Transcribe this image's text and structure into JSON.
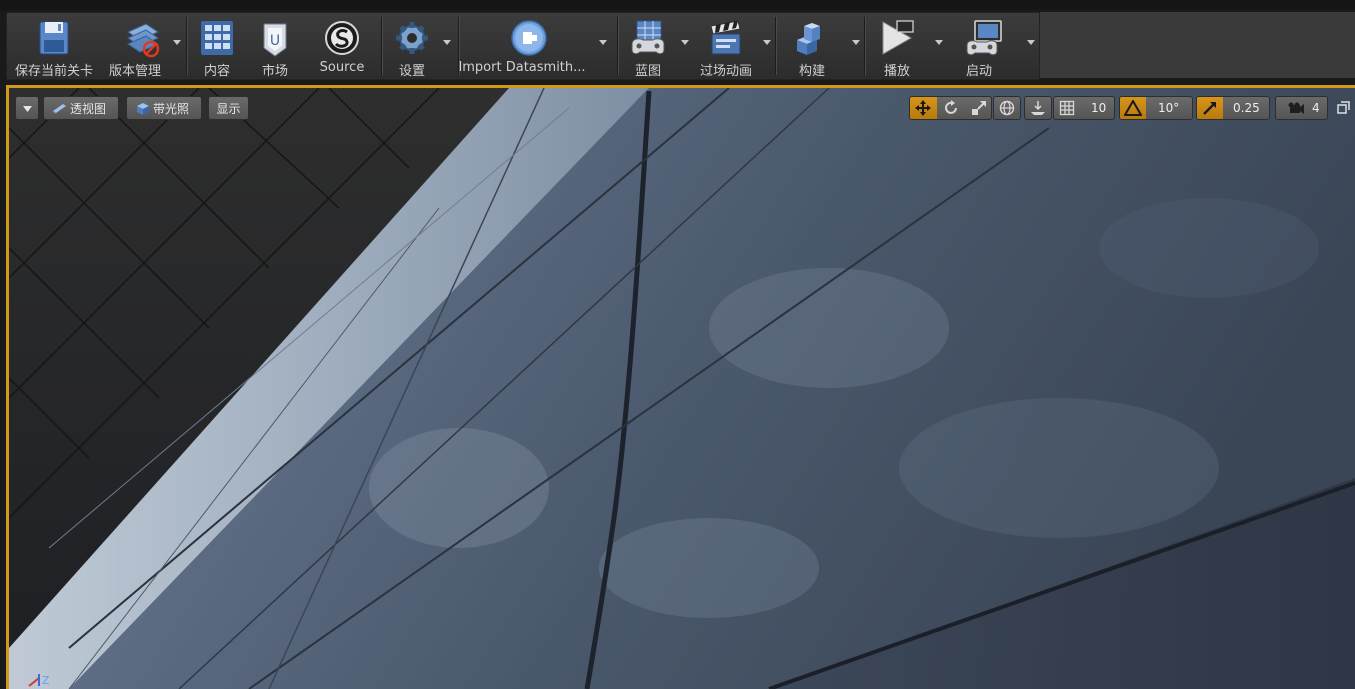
{
  "toolbar": {
    "save": "保存当前关卡",
    "source_control": "版本管理",
    "content": "内容",
    "marketplace": "市场",
    "source": "Source",
    "settings": "设置",
    "import_datasmith": "Import Datasmith...",
    "blueprints": "蓝图",
    "cinematics": "过场动画",
    "build": "构建",
    "play": "播放",
    "launch": "启动"
  },
  "viewport": {
    "perspective": "透视图",
    "lit": "带光照",
    "show": "显示",
    "grid_snap": "10",
    "rotation_snap": "10°",
    "scale_snap": "0.25",
    "camera_speed": "4",
    "axis_label": "Z"
  },
  "colors": {
    "accent": "#d09a1b",
    "toolbar_bg": "#333333",
    "label": "#d0d0d0"
  }
}
